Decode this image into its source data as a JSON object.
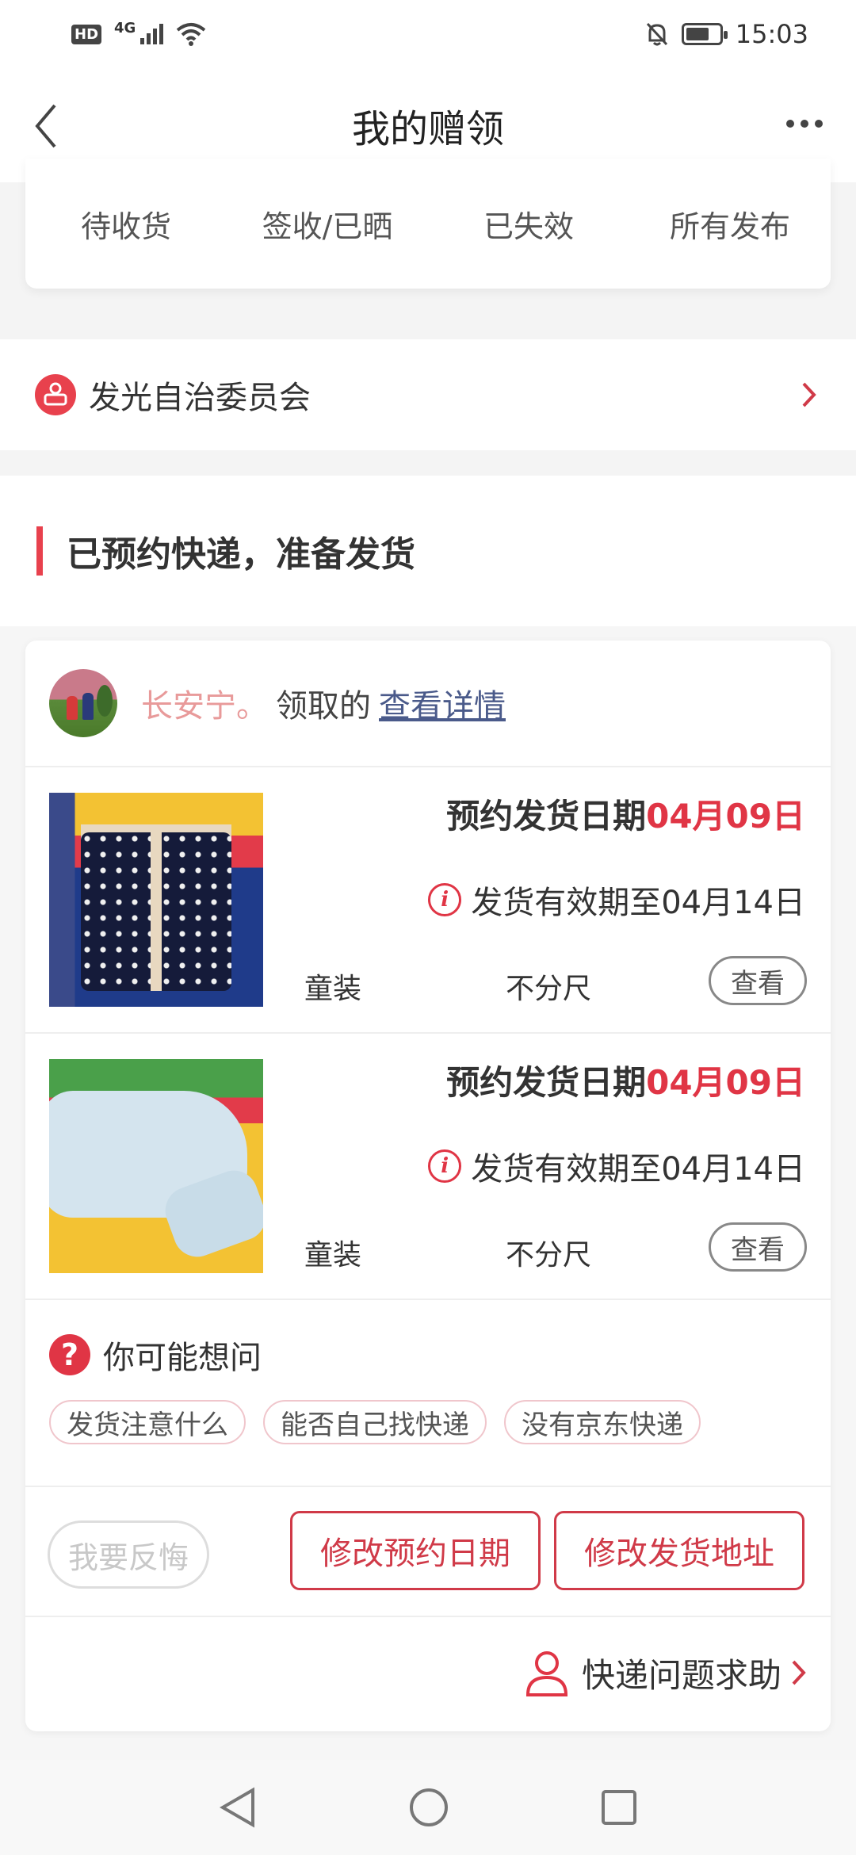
{
  "status_bar": {
    "hd": "HD",
    "network": "4G",
    "time": "15:03"
  },
  "header": {
    "title": "我的赠领"
  },
  "stats": [
    {
      "label": "待收货"
    },
    {
      "label": "签收/已晒"
    },
    {
      "label": "已失效"
    },
    {
      "label": "所有发布"
    }
  ],
  "org": {
    "name": "发光自治委员会"
  },
  "section": {
    "title": "已预约快递，准备发货"
  },
  "order": {
    "recipient": "长安宁。",
    "claimed": "领取的",
    "detail_link": "查看详情",
    "items": [
      {
        "date_label": "预约发货日期",
        "date_value": "04月09日",
        "valid_text": "发货有效期至04月14日",
        "category": "童装",
        "size": "不分尺",
        "view_label": "查看"
      },
      {
        "date_label": "预约发货日期",
        "date_value": "04月09日",
        "valid_text": "发货有效期至04月14日",
        "category": "童装",
        "size": "不分尺",
        "view_label": "查看"
      }
    ],
    "faq": {
      "title": "你可能想问",
      "chips": [
        "发货注意什么",
        "能否自己找快递",
        "没有京东快递"
      ]
    },
    "actions": {
      "regret": "我要反悔",
      "modify_date": "修改预约日期",
      "modify_address": "修改发货地址"
    },
    "help": "快递问题求助"
  },
  "colors": {
    "accent": "#e03545",
    "link": "#4a5a8a",
    "recipient": "#e89a9a"
  }
}
